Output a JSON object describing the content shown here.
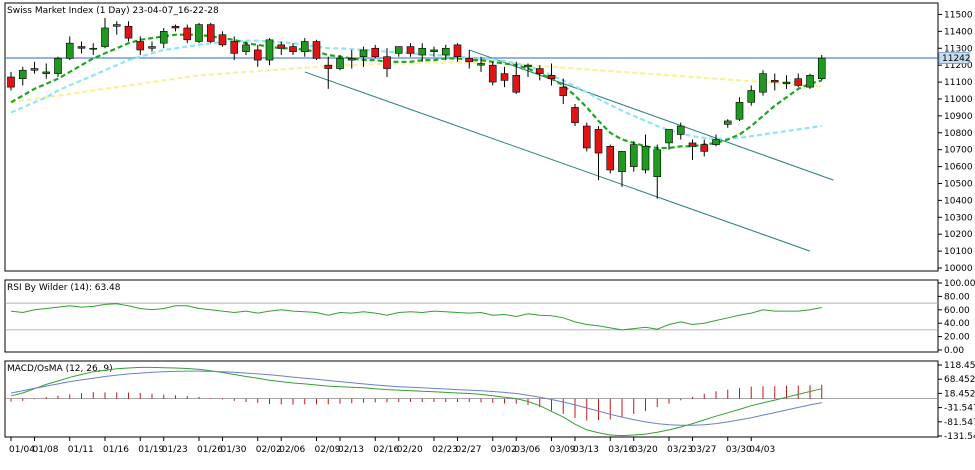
{
  "chart_data": [
    {
      "type": "candlestick",
      "title": "Swiss Market Index (1 Day) 23-04-07_16-22-28",
      "current_price_label": "11242",
      "current_price": 11242,
      "ylim": [
        10000,
        11550
      ],
      "y_ticks": [
        10000,
        10100,
        10200,
        10300,
        10400,
        10500,
        10600,
        10700,
        10800,
        10900,
        11000,
        11100,
        11200,
        11300,
        11400,
        11500
      ],
      "x_tick_labels": [
        {
          "label": "01/04",
          "index": 0
        },
        {
          "label": "01/08",
          "index": 2
        },
        {
          "label": "01/11",
          "index": 5
        },
        {
          "label": "01/16",
          "index": 8
        },
        {
          "label": "01/19",
          "index": 11
        },
        {
          "label": "01/23",
          "index": 13
        },
        {
          "label": "01/26",
          "index": 16
        },
        {
          "label": "01/30",
          "index": 18
        },
        {
          "label": "02/02",
          "index": 21
        },
        {
          "label": "02/06",
          "index": 23
        },
        {
          "label": "02/09",
          "index": 26
        },
        {
          "label": "02/13",
          "index": 28
        },
        {
          "label": "02/16",
          "index": 31
        },
        {
          "label": "02/20",
          "index": 33
        },
        {
          "label": "02/23",
          "index": 36
        },
        {
          "label": "02/27",
          "index": 38
        },
        {
          "label": "03/02",
          "index": 41
        },
        {
          "label": "03/06",
          "index": 43
        },
        {
          "label": "03/09",
          "index": 46
        },
        {
          "label": "03/13",
          "index": 48
        },
        {
          "label": "03/16",
          "index": 51
        },
        {
          "label": "03/20",
          "index": 53
        },
        {
          "label": "03/23",
          "index": 56
        },
        {
          "label": "03/27",
          "index": 58
        },
        {
          "label": "03/30",
          "index": 61
        },
        {
          "label": "04/03",
          "index": 63
        }
      ],
      "candles": [
        {
          "o": 11130,
          "h": 11160,
          "l": 11050,
          "c": 11070
        },
        {
          "o": 11120,
          "h": 11190,
          "l": 11080,
          "c": 11170
        },
        {
          "o": 11170,
          "h": 11220,
          "l": 11150,
          "c": 11180
        },
        {
          "o": 11150,
          "h": 11210,
          "l": 11120,
          "c": 11160
        },
        {
          "o": 11150,
          "h": 11250,
          "l": 11130,
          "c": 11240
        },
        {
          "o": 11240,
          "h": 11370,
          "l": 11230,
          "c": 11330
        },
        {
          "o": 11310,
          "h": 11340,
          "l": 11270,
          "c": 11300
        },
        {
          "o": 11300,
          "h": 11330,
          "l": 11260,
          "c": 11300
        },
        {
          "o": 11310,
          "h": 11480,
          "l": 11300,
          "c": 11420
        },
        {
          "o": 11430,
          "h": 11460,
          "l": 11380,
          "c": 11440
        },
        {
          "o": 11430,
          "h": 11460,
          "l": 11340,
          "c": 11360
        },
        {
          "o": 11340,
          "h": 11370,
          "l": 11260,
          "c": 11290
        },
        {
          "o": 11300,
          "h": 11340,
          "l": 11280,
          "c": 11310
        },
        {
          "o": 11330,
          "h": 11420,
          "l": 11300,
          "c": 11400
        },
        {
          "o": 11430,
          "h": 11440,
          "l": 11400,
          "c": 11420
        },
        {
          "o": 11420,
          "h": 11440,
          "l": 11330,
          "c": 11350
        },
        {
          "o": 11340,
          "h": 11450,
          "l": 11330,
          "c": 11440
        },
        {
          "o": 11440,
          "h": 11450,
          "l": 11330,
          "c": 11340
        },
        {
          "o": 11380,
          "h": 11400,
          "l": 11310,
          "c": 11320
        },
        {
          "o": 11340,
          "h": 11370,
          "l": 11230,
          "c": 11270
        },
        {
          "o": 11280,
          "h": 11340,
          "l": 11260,
          "c": 11320
        },
        {
          "o": 11290,
          "h": 11320,
          "l": 11190,
          "c": 11230
        },
        {
          "o": 11230,
          "h": 11360,
          "l": 11200,
          "c": 11350
        },
        {
          "o": 11320,
          "h": 11340,
          "l": 11260,
          "c": 11300
        },
        {
          "o": 11310,
          "h": 11330,
          "l": 11260,
          "c": 11280
        },
        {
          "o": 11280,
          "h": 11360,
          "l": 11250,
          "c": 11340
        },
        {
          "o": 11340,
          "h": 11350,
          "l": 11230,
          "c": 11240
        },
        {
          "o": 11200,
          "h": 11250,
          "l": 11060,
          "c": 11180
        },
        {
          "o": 11180,
          "h": 11260,
          "l": 11170,
          "c": 11240
        },
        {
          "o": 11230,
          "h": 11290,
          "l": 11180,
          "c": 11240
        },
        {
          "o": 11250,
          "h": 11310,
          "l": 11190,
          "c": 11290
        },
        {
          "o": 11300,
          "h": 11320,
          "l": 11240,
          "c": 11250
        },
        {
          "o": 11250,
          "h": 11300,
          "l": 11130,
          "c": 11180
        },
        {
          "o": 11270,
          "h": 11310,
          "l": 11250,
          "c": 11310
        },
        {
          "o": 11310,
          "h": 11330,
          "l": 11250,
          "c": 11270
        },
        {
          "o": 11260,
          "h": 11330,
          "l": 11220,
          "c": 11300
        },
        {
          "o": 11280,
          "h": 11310,
          "l": 11250,
          "c": 11290
        },
        {
          "o": 11260,
          "h": 11320,
          "l": 11230,
          "c": 11300
        },
        {
          "o": 11320,
          "h": 11330,
          "l": 11220,
          "c": 11250
        },
        {
          "o": 11240,
          "h": 11290,
          "l": 11180,
          "c": 11220
        },
        {
          "o": 11200,
          "h": 11250,
          "l": 11160,
          "c": 11210
        },
        {
          "o": 11200,
          "h": 11220,
          "l": 11080,
          "c": 11100
        },
        {
          "o": 11150,
          "h": 11190,
          "l": 11070,
          "c": 11110
        },
        {
          "o": 11140,
          "h": 11220,
          "l": 11030,
          "c": 11040
        },
        {
          "o": 11190,
          "h": 11210,
          "l": 11130,
          "c": 11200
        },
        {
          "o": 11180,
          "h": 11200,
          "l": 11110,
          "c": 11150
        },
        {
          "o": 11140,
          "h": 11210,
          "l": 11080,
          "c": 11120
        },
        {
          "o": 11070,
          "h": 11120,
          "l": 10970,
          "c": 11020
        },
        {
          "o": 10950,
          "h": 10970,
          "l": 10840,
          "c": 10860
        },
        {
          "o": 10840,
          "h": 10860,
          "l": 10690,
          "c": 10710
        },
        {
          "o": 10820,
          "h": 10840,
          "l": 10520,
          "c": 10680
        },
        {
          "o": 10720,
          "h": 10730,
          "l": 10560,
          "c": 10580
        },
        {
          "o": 10570,
          "h": 10590,
          "l": 10480,
          "c": 10690
        },
        {
          "o": 10600,
          "h": 10750,
          "l": 10570,
          "c": 10730
        },
        {
          "o": 10580,
          "h": 10790,
          "l": 10560,
          "c": 10720
        },
        {
          "o": 10540,
          "h": 10730,
          "l": 10410,
          "c": 10700
        },
        {
          "o": 10740,
          "h": 10760,
          "l": 10700,
          "c": 10820
        },
        {
          "o": 10790,
          "h": 10860,
          "l": 10760,
          "c": 10840
        },
        {
          "o": 10740,
          "h": 10760,
          "l": 10640,
          "c": 10720
        },
        {
          "o": 10730,
          "h": 10760,
          "l": 10660,
          "c": 10690
        },
        {
          "o": 10730,
          "h": 10790,
          "l": 10720,
          "c": 10760
        },
        {
          "o": 10850,
          "h": 10880,
          "l": 10830,
          "c": 10870
        },
        {
          "o": 10880,
          "h": 11010,
          "l": 10870,
          "c": 10980
        },
        {
          "o": 10980,
          "h": 11080,
          "l": 10960,
          "c": 11050
        },
        {
          "o": 11040,
          "h": 11170,
          "l": 11020,
          "c": 11150
        },
        {
          "o": 11110,
          "h": 11150,
          "l": 11050,
          "c": 11100
        },
        {
          "o": 11090,
          "h": 11140,
          "l": 11060,
          "c": 11100
        },
        {
          "o": 11120,
          "h": 11150,
          "l": 11070,
          "c": 11080
        },
        {
          "o": 11070,
          "h": 11150,
          "l": 11060,
          "c": 11140
        },
        {
          "o": 11120,
          "h": 11260,
          "l": 11110,
          "c": 11242
        }
      ],
      "ma_green_dashed": [
        10980,
        11020,
        11060,
        11090,
        11120,
        11160,
        11200,
        11240,
        11270,
        11300,
        11330,
        11350,
        11360,
        11370,
        11380,
        11380,
        11380,
        11370,
        11360,
        11350,
        11330,
        11320,
        11310,
        11300,
        11300,
        11290,
        11280,
        11260,
        11250,
        11240,
        11230,
        11230,
        11220,
        11220,
        11220,
        11230,
        11230,
        11240,
        11240,
        11230,
        11230,
        11220,
        11210,
        11200,
        11180,
        11150,
        11120,
        11080,
        11020,
        10950,
        10870,
        10800,
        10760,
        10740,
        10720,
        10710,
        10710,
        10720,
        10720,
        10730,
        10740,
        10760,
        10790,
        10840,
        10900,
        10960,
        11010,
        11060,
        11090,
        11110
      ],
      "ma_cyan_dashed": [
        10920,
        10950,
        10980,
        11010,
        11050,
        11080,
        11110,
        11140,
        11170,
        11200,
        11230,
        11250,
        11270,
        11290,
        11300,
        11310,
        11320,
        11330,
        11335,
        11340,
        11345,
        11345,
        11340,
        11335,
        11330,
        11320,
        11310,
        11300,
        11300,
        11295,
        11290,
        11285,
        11280,
        11275,
        11270,
        11265,
        11260,
        11255,
        11250,
        11245,
        11240,
        11235,
        11225,
        11210,
        11195,
        11170,
        11140,
        11110,
        11075,
        11040,
        11000,
        10965,
        10930,
        10900,
        10870,
        10840,
        10815,
        10795,
        10780,
        10770,
        10765,
        10765,
        10770,
        10780,
        10790,
        10800,
        10810,
        10820,
        10830,
        10840
      ],
      "ma_yellow_dashed": [
        10980,
        10990,
        11000,
        11010,
        11020,
        11030,
        11040,
        11050,
        11060,
        11070,
        11080,
        11090,
        11100,
        11110,
        11120,
        11130,
        11140,
        11145,
        11150,
        11155,
        11160,
        11165,
        11170,
        11175,
        11180,
        11185,
        11190,
        11195,
        11200,
        11200,
        11205,
        11205,
        11210,
        11210,
        11210,
        11215,
        11215,
        11215,
        11215,
        11215,
        11215,
        11215,
        11210,
        11205,
        11200,
        11195,
        11190,
        11185,
        11180,
        11175,
        11170,
        11165,
        11160,
        11155,
        11150,
        11145,
        11140,
        11135,
        11130,
        11125,
        11120,
        11115,
        11110,
        11105,
        11100,
        11095,
        11090,
        11085,
        11080,
        11075
      ],
      "channel_lines": [
        {
          "from": {
            "index": 25,
            "value": 11160
          },
          "to": {
            "index": 68,
            "value": 10100
          }
        },
        {
          "from": {
            "index": 39,
            "value": 11290
          },
          "to": {
            "index": 70,
            "value": 10520
          }
        }
      ]
    },
    {
      "type": "line",
      "title": "RSI By Wilder (14): 63.48",
      "ylim": [
        0,
        100
      ],
      "y_ticks": [
        0,
        20,
        40,
        60,
        80,
        100
      ],
      "y_tick_labels": [
        "0.00",
        "20.00",
        "40.00",
        "60.00",
        "80.00",
        "100.00"
      ],
      "levels": [
        70,
        30
      ],
      "series": [
        {
          "values": [
            58,
            56,
            60,
            62,
            64,
            66,
            64,
            65,
            68,
            69,
            66,
            62,
            60,
            62,
            66,
            66,
            62,
            60,
            58,
            56,
            58,
            55,
            58,
            60,
            58,
            57,
            56,
            52,
            56,
            55,
            57,
            55,
            52,
            56,
            57,
            56,
            58,
            57,
            56,
            55,
            56,
            52,
            53,
            50,
            54,
            52,
            51,
            48,
            42,
            38,
            36,
            33,
            30,
            32,
            34,
            31,
            38,
            42,
            38,
            40,
            44,
            48,
            52,
            55,
            60,
            58,
            58,
            58,
            60,
            63.48
          ]
        }
      ]
    },
    {
      "type": "line_bar",
      "title": "MACD/OsMA (12, 26, 9)",
      "ylim": [
        -131.5473,
        118.4527
      ],
      "y_ticks": [
        118.4527,
        68.4527,
        18.4527,
        -31.5473,
        -81.5473,
        -131.5473
      ],
      "y_tick_labels": [
        "118.4527",
        "68.4527",
        "18.4527",
        "-31.5472",
        "-81.5472",
        "-131.547"
      ],
      "series": [
        {
          "name": "",
          "color": "#33a033",
          "values": [
            10,
            20,
            35,
            50,
            62,
            75,
            85,
            95,
            100,
            105,
            108,
            110,
            110,
            109,
            108,
            106,
            103,
            98,
            92,
            85,
            78,
            72,
            65,
            60,
            55,
            52,
            48,
            44,
            42,
            40,
            38,
            35,
            32,
            30,
            28,
            26,
            24,
            22,
            20,
            18,
            15,
            10,
            5,
            0,
            -10,
            -25,
            -45,
            -65,
            -90,
            -110,
            -120,
            -128,
            -130,
            -128,
            -125,
            -118,
            -110,
            -100,
            -88,
            -75,
            -62,
            -50,
            -38,
            -25,
            -15,
            -5,
            5,
            15,
            25,
            35
          ]
        },
        {
          "name": "",
          "color": "#6a80c8",
          "values": [
            20,
            28,
            36,
            44,
            52,
            60,
            66,
            72,
            78,
            83,
            87,
            90,
            93,
            95,
            96,
            97,
            97,
            96,
            95,
            93,
            90,
            87,
            84,
            80,
            76,
            72,
            68,
            64,
            60,
            56,
            52,
            48,
            45,
            42,
            40,
            38,
            36,
            34,
            32,
            30,
            28,
            25,
            22,
            18,
            12,
            5,
            -3,
            -12,
            -22,
            -33,
            -44,
            -55,
            -65,
            -74,
            -82,
            -88,
            -92,
            -94,
            -94,
            -92,
            -88,
            -82,
            -75,
            -67,
            -58,
            -49,
            -40,
            -31,
            -22,
            -14
          ]
        }
      ],
      "histogram": [
        -10,
        -8,
        -2,
        6,
        10,
        15,
        19,
        23,
        22,
        22,
        21,
        20,
        17,
        14,
        12,
        9,
        6,
        2,
        -3,
        -8,
        -12,
        -15,
        -19,
        -20,
        -21,
        -20,
        -20,
        -20,
        -18,
        -16,
        -14,
        -13,
        -13,
        -12,
        -12,
        -12,
        -12,
        -12,
        -12,
        -12,
        -13,
        -15,
        -17,
        -18,
        -22,
        -30,
        -42,
        -53,
        -68,
        -77,
        -76,
        -73,
        -65,
        -54,
        -43,
        -30,
        -18,
        -6,
        6,
        17,
        26,
        32,
        37,
        42,
        43,
        44,
        45,
        46,
        47,
        49
      ]
    }
  ]
}
